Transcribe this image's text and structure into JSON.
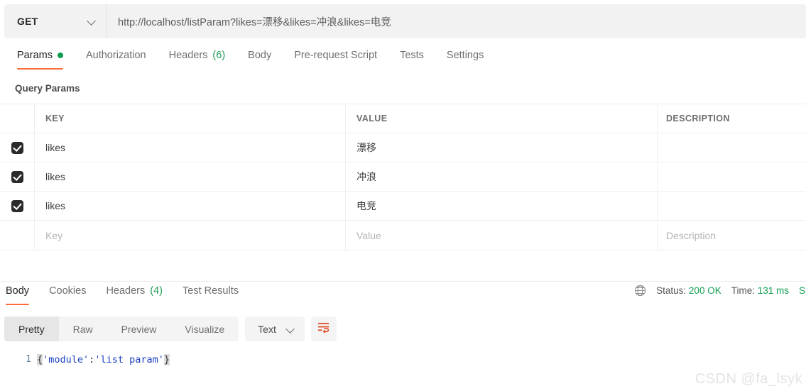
{
  "request": {
    "method": "GET",
    "method_icon": "chevron-down-icon",
    "url": "http://localhost/listParam?likes=漂移&likes=冲浪&likes=电竞",
    "tabs": [
      {
        "label": "Params",
        "dot": true,
        "active": true
      },
      {
        "label": "Authorization",
        "active": false
      },
      {
        "label": "Headers",
        "count": "(6)",
        "active": false
      },
      {
        "label": "Body",
        "active": false
      },
      {
        "label": "Pre-request Script",
        "active": false
      },
      {
        "label": "Tests",
        "active": false
      },
      {
        "label": "Settings",
        "active": false
      }
    ]
  },
  "query_params": {
    "title": "Query Params",
    "columns": {
      "key": "KEY",
      "value": "VALUE",
      "description": "DESCRIPTION"
    },
    "rows": [
      {
        "checked": true,
        "key": "likes",
        "value": "漂移",
        "description": ""
      },
      {
        "checked": true,
        "key": "likes",
        "value": "冲浪",
        "description": ""
      },
      {
        "checked": true,
        "key": "likes",
        "value": "电竞",
        "description": ""
      }
    ],
    "placeholder_row": {
      "key": "Key",
      "value": "Value",
      "description": "Description"
    }
  },
  "response": {
    "tabs": [
      {
        "label": "Body",
        "active": true
      },
      {
        "label": "Cookies",
        "active": false
      },
      {
        "label": "Headers",
        "count": "(4)",
        "active": false
      },
      {
        "label": "Test Results",
        "active": false
      }
    ],
    "meta": {
      "globe_icon": "globe-icon",
      "status_label": "Status:",
      "status_value": "200 OK",
      "time_label": "Time:",
      "time_value": "131 ms",
      "size_label_cut": "S"
    },
    "view_modes": [
      {
        "label": "Pretty",
        "active": true
      },
      {
        "label": "Raw",
        "active": false
      },
      {
        "label": "Preview",
        "active": false
      },
      {
        "label": "Visualize",
        "active": false
      }
    ],
    "format": {
      "label": "Text",
      "icon": "chevron-down-icon"
    },
    "wrap_button_icon": "wrap-text-icon",
    "body": {
      "line_number": "1",
      "open_brace": "{",
      "key": "'module'",
      "colon": ":",
      "value": "'list param'",
      "close_brace": "}"
    }
  },
  "watermark": "CSDN @fa_lsyk",
  "colors": {
    "accent": "#ff6c37",
    "success": "#0f9d4f",
    "toolbar_bg": "#f2f2f2",
    "string": "#1a3fbf"
  }
}
